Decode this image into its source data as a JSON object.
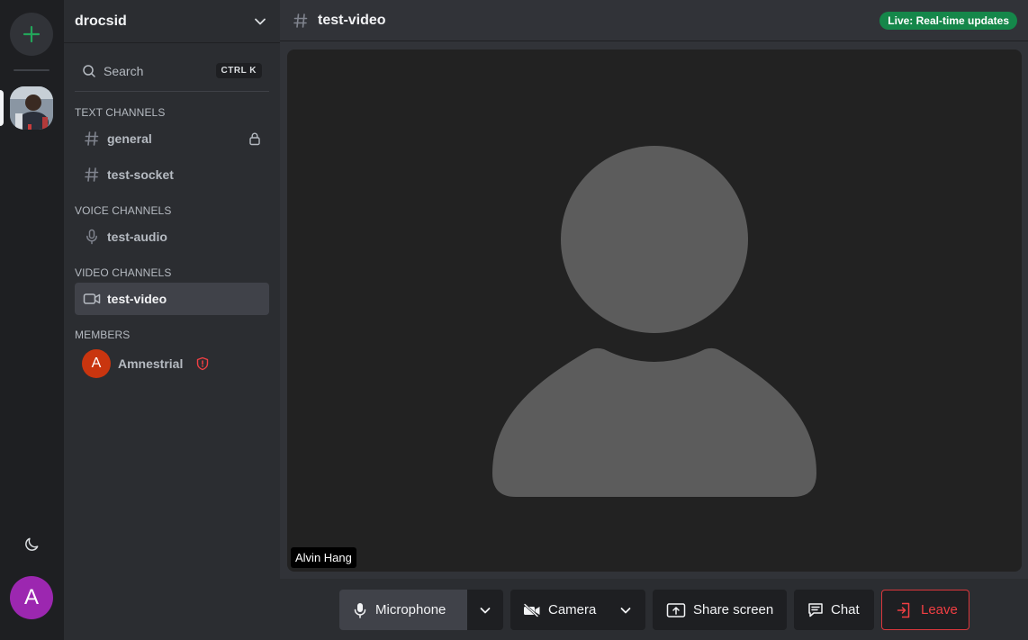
{
  "server": {
    "name": "drocsid"
  },
  "search": {
    "label": "Search",
    "shortcut": "CTRL K"
  },
  "sections": {
    "text": "TEXT CHANNELS",
    "voice": "VOICE CHANNELS",
    "video": "VIDEO CHANNELS",
    "members": "MEMBERS"
  },
  "text_channels": [
    {
      "name": "general",
      "locked": true
    },
    {
      "name": "test-socket",
      "locked": false
    }
  ],
  "voice_channels": [
    {
      "name": "test-audio"
    }
  ],
  "video_channels": [
    {
      "name": "test-video",
      "active": true
    }
  ],
  "members": [
    {
      "initial": "A",
      "name": "Amnestrial",
      "role_icon": "shield-alert-icon"
    }
  ],
  "user": {
    "initial": "A"
  },
  "header": {
    "channel": "test-video",
    "badge": "Live: Real-time updates"
  },
  "video": {
    "participant_name": "Alvin Hang"
  },
  "controls": {
    "microphone": "Microphone",
    "camera": "Camera",
    "share_screen": "Share screen",
    "chat": "Chat",
    "leave": "Leave"
  },
  "colors": {
    "accent_green": "#15874a",
    "danger": "#f23f43",
    "user_avatar": "#9c27b0",
    "member_avatar": "#c9350f"
  }
}
